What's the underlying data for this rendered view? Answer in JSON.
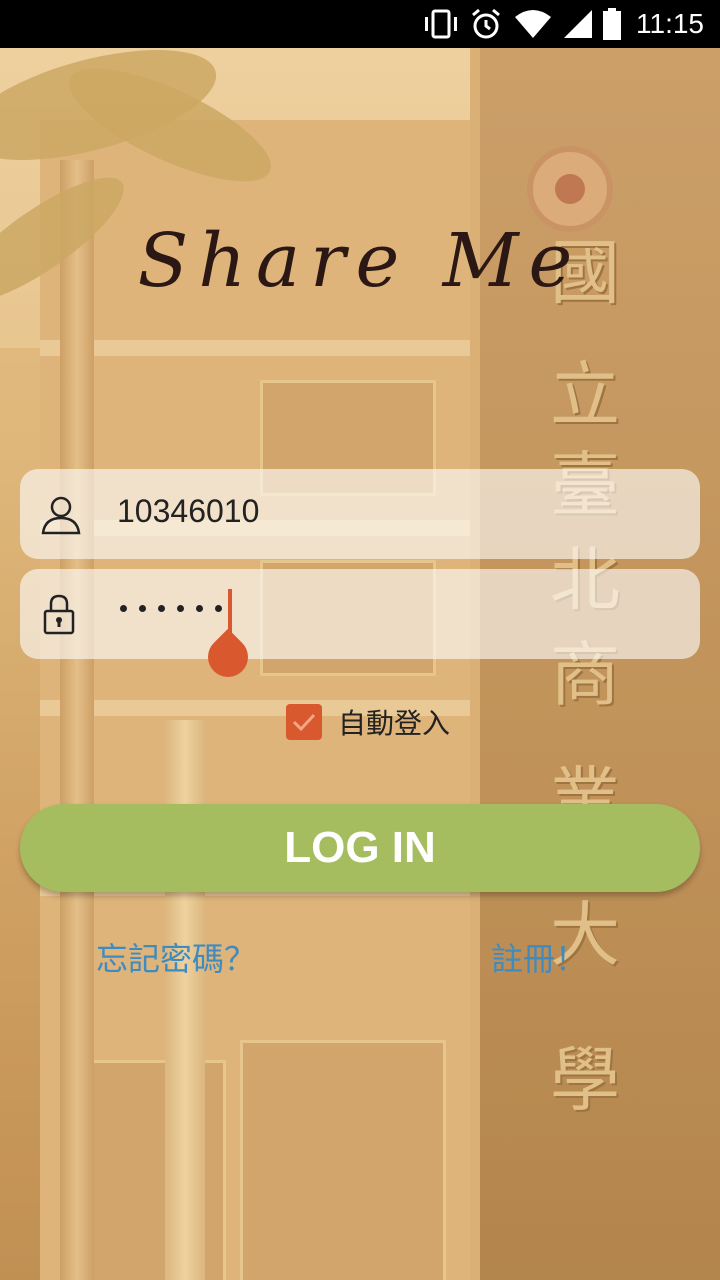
{
  "status_bar": {
    "time": "11:15",
    "icons": [
      "vibrate-icon",
      "alarm-icon",
      "wifi-icon",
      "cellular-signal-icon",
      "battery-icon"
    ]
  },
  "background": {
    "carved_characters": [
      "國",
      "立",
      "臺",
      "北",
      "商",
      "業",
      "大",
      "學"
    ]
  },
  "app_title": "Share  Me",
  "login_form": {
    "username_value": "10346010",
    "username_icon": "user-icon",
    "password_masked_length": 6,
    "password_icon": "lock-icon",
    "auto_login_label": "自動登入",
    "auto_login_checked": true,
    "login_button_label": "LOG IN",
    "forgot_password_label": "忘記密碼？",
    "register_label": "註冊！"
  },
  "colors": {
    "accent": "#d9582e",
    "login_button": "#a5bd5f",
    "link": "#3f8bc0"
  }
}
